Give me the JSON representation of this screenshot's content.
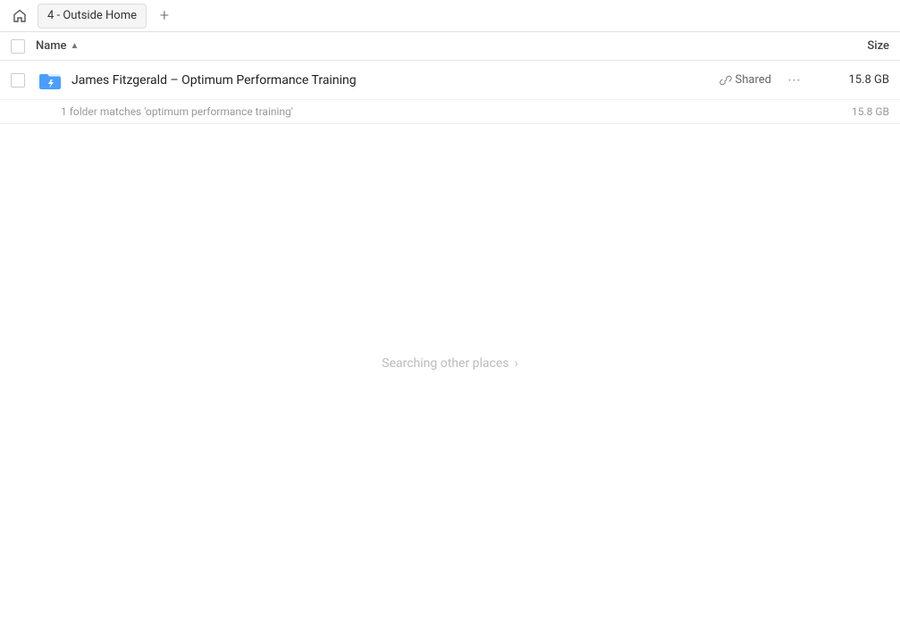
{
  "topbar": {
    "home_icon": "🏠",
    "separator": ">",
    "tab_label": "4 - Outside Home",
    "add_tab_icon": "+"
  },
  "columns": {
    "name_label": "Name",
    "sort_icon": "▲",
    "size_label": "Size"
  },
  "file_row": {
    "name": "James Fitzgerald – Optimum Performance Training",
    "shared_label": "Shared",
    "more_icon": "•••",
    "size": "15.8 GB"
  },
  "match_row": {
    "text": "1 folder matches 'optimum performance training'",
    "size": "15.8 GB"
  },
  "searching": {
    "text": "Searching other places",
    "chevron": "›"
  }
}
